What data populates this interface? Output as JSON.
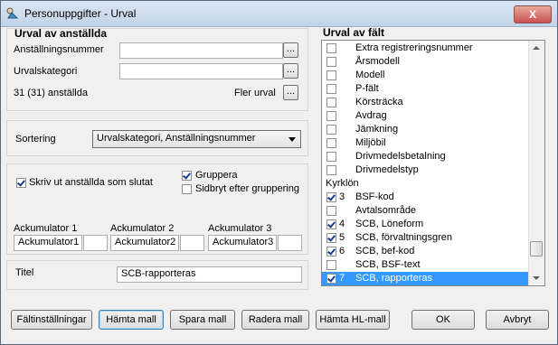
{
  "window": {
    "title": "Personuppgifter - Urval",
    "close_glyph": "X"
  },
  "selection": {
    "heading": "Urval av anställda",
    "employee_number_label": "Anställningsnummer",
    "employee_number_value": "",
    "category_label": "Urvalskategori",
    "category_value": "",
    "browse_glyph": "...",
    "count_text": "31 (31) anställda",
    "more_selection_label": "Fler urval"
  },
  "sorting": {
    "label": "Sortering",
    "value": "Urvalskategori, Anställningsnummer"
  },
  "options": {
    "print_terminated_label": "Skriv ut anställda som slutat",
    "print_terminated_checked": true,
    "group_label": "Gruppera",
    "group_checked": true,
    "page_break_label": "Sidbryt efter gruppering",
    "page_break_checked": false
  },
  "accumulators": [
    {
      "label": "Ackumulator 1",
      "value": "Ackumulator1",
      "extra": ""
    },
    {
      "label": "Ackumulator 2",
      "value": "Ackumulator2",
      "extra": ""
    },
    {
      "label": "Ackumulator 3",
      "value": "Ackumulator3",
      "extra": ""
    }
  ],
  "title_field": {
    "label": "Titel",
    "value": "SCB-rapporteras"
  },
  "fields": {
    "heading": "Urval av fält",
    "items": [
      {
        "num": "",
        "label": "Extra registreringsnummer",
        "checked": false,
        "group": false,
        "selected": false
      },
      {
        "num": "",
        "label": "Årsmodell",
        "checked": false,
        "group": false,
        "selected": false
      },
      {
        "num": "",
        "label": "Modell",
        "checked": false,
        "group": false,
        "selected": false
      },
      {
        "num": "",
        "label": "P-fält",
        "checked": false,
        "group": false,
        "selected": false
      },
      {
        "num": "",
        "label": "Körsträcka",
        "checked": false,
        "group": false,
        "selected": false
      },
      {
        "num": "",
        "label": "Avdrag",
        "checked": false,
        "group": false,
        "selected": false
      },
      {
        "num": "",
        "label": "Jämkning",
        "checked": false,
        "group": false,
        "selected": false
      },
      {
        "num": "",
        "label": "Miljöbil",
        "checked": false,
        "group": false,
        "selected": false
      },
      {
        "num": "",
        "label": "Drivmedelsbetalning",
        "checked": false,
        "group": false,
        "selected": false
      },
      {
        "num": "",
        "label": "Drivmedelstyp",
        "checked": false,
        "group": false,
        "selected": false
      },
      {
        "num": "",
        "label": "Kyrklön",
        "checked": false,
        "group": true,
        "selected": false
      },
      {
        "num": "3",
        "label": "BSF-kod",
        "checked": true,
        "group": false,
        "selected": false
      },
      {
        "num": "",
        "label": "Avtalsområde",
        "checked": false,
        "group": false,
        "selected": false
      },
      {
        "num": "4",
        "label": "SCB, Löneform",
        "checked": true,
        "group": false,
        "selected": false
      },
      {
        "num": "5",
        "label": "SCB, förvaltningsgren",
        "checked": true,
        "group": false,
        "selected": false
      },
      {
        "num": "6",
        "label": "SCB, bef-kod",
        "checked": true,
        "group": false,
        "selected": false
      },
      {
        "num": "",
        "label": "SCB, BSF-text",
        "checked": false,
        "group": false,
        "selected": false
      },
      {
        "num": "7",
        "label": "SCB, rapporteras",
        "checked": true,
        "group": false,
        "selected": true
      }
    ]
  },
  "buttons": {
    "field_settings": "Fältinställningar",
    "get_template": "Hämta mall",
    "save_template": "Spara mall",
    "delete_template": "Radera mall",
    "get_hl_template": "Hämta HL-mall",
    "ok": "OK",
    "cancel": "Avbryt"
  }
}
